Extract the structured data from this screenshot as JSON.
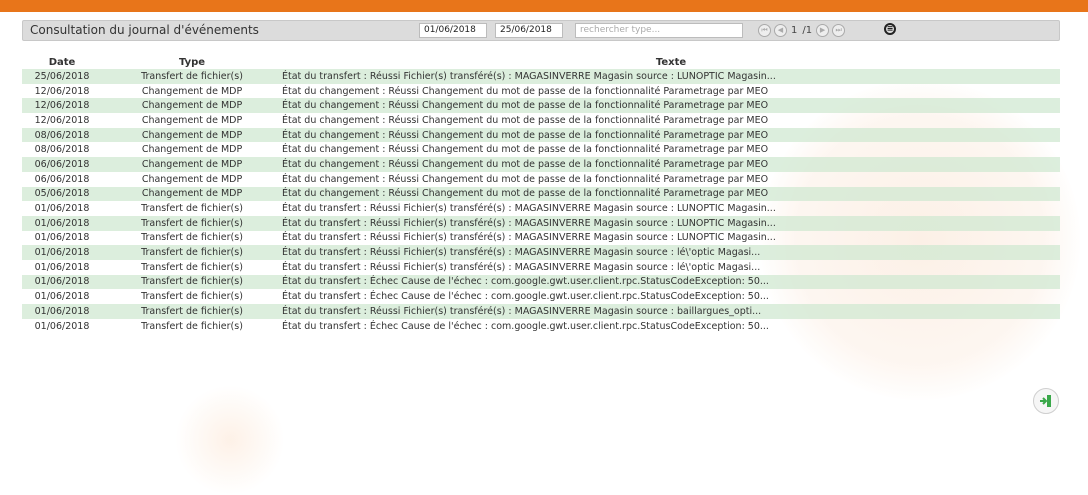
{
  "header": {
    "title": "Consultation du journal d'événements",
    "date_from": "01/06/2018",
    "date_to": "25/06/2018",
    "search_placeholder": "rechercher type...",
    "page_current": "1",
    "page_total": "/1"
  },
  "colors": {
    "topbar": "#e8751a",
    "row_alt": "#d0e8d1",
    "exit_icon": "#3aa84a"
  },
  "table": {
    "columns": [
      "Date",
      "Type",
      "Texte"
    ],
    "rows": [
      {
        "date": "25/06/2018",
        "type": "Transfert de fichier(s)",
        "texte": "État du transfert : Réussi Fichier(s) transféré(s) : MAGASINVERRE Magasin source : LUNOPTIC Magasin..."
      },
      {
        "date": "12/06/2018",
        "type": "Changement de MDP",
        "texte": "État du changement : Réussi Changement du mot de passe de la fonctionnalité Parametrage par MEO"
      },
      {
        "date": "12/06/2018",
        "type": "Changement de MDP",
        "texte": "État du changement : Réussi Changement du mot de passe de la fonctionnalité Parametrage par MEO"
      },
      {
        "date": "12/06/2018",
        "type": "Changement de MDP",
        "texte": "État du changement : Réussi Changement du mot de passe de la fonctionnalité Parametrage par MEO"
      },
      {
        "date": "08/06/2018",
        "type": "Changement de MDP",
        "texte": "État du changement : Réussi Changement du mot de passe de la fonctionnalité Parametrage par MEO"
      },
      {
        "date": "08/06/2018",
        "type": "Changement de MDP",
        "texte": "État du changement : Réussi Changement du mot de passe de la fonctionnalité Parametrage par MEO"
      },
      {
        "date": "06/06/2018",
        "type": "Changement de MDP",
        "texte": "État du changement : Réussi Changement du mot de passe de la fonctionnalité Parametrage par MEO"
      },
      {
        "date": "06/06/2018",
        "type": "Changement de MDP",
        "texte": "État du changement : Réussi Changement du mot de passe de la fonctionnalité Parametrage par MEO"
      },
      {
        "date": "05/06/2018",
        "type": "Changement de MDP",
        "texte": "État du changement : Réussi Changement du mot de passe de la fonctionnalité Parametrage par MEO"
      },
      {
        "date": "01/06/2018",
        "type": "Transfert de fichier(s)",
        "texte": "État du transfert : Réussi Fichier(s) transféré(s) : MAGASINVERRE Magasin source : LUNOPTIC Magasin..."
      },
      {
        "date": "01/06/2018",
        "type": "Transfert de fichier(s)",
        "texte": "État du transfert : Réussi Fichier(s) transféré(s) : MAGASINVERRE Magasin source : LUNOPTIC Magasin..."
      },
      {
        "date": "01/06/2018",
        "type": "Transfert de fichier(s)",
        "texte": "État du transfert : Réussi Fichier(s) transféré(s) : MAGASINVERRE Magasin source : LUNOPTIC Magasin..."
      },
      {
        "date": "01/06/2018",
        "type": "Transfert de fichier(s)",
        "texte": "État du transfert : Réussi Fichier(s) transféré(s) : MAGASINVERRE Magasin source : lé\\'optic Magasi..."
      },
      {
        "date": "01/06/2018",
        "type": "Transfert de fichier(s)",
        "texte": "État du transfert : Réussi Fichier(s) transféré(s) : MAGASINVERRE Magasin source : lé\\'optic Magasi..."
      },
      {
        "date": "01/06/2018",
        "type": "Transfert de fichier(s)",
        "texte": "État du transfert : Échec Cause de l'échec : com.google.gwt.user.client.rpc.StatusCodeException: 50..."
      },
      {
        "date": "01/06/2018",
        "type": "Transfert de fichier(s)",
        "texte": "État du transfert : Échec Cause de l'échec : com.google.gwt.user.client.rpc.StatusCodeException: 50..."
      },
      {
        "date": "01/06/2018",
        "type": "Transfert de fichier(s)",
        "texte": "État du transfert : Réussi Fichier(s) transféré(s) : MAGASINVERRE Magasin source : baillargues_opti..."
      },
      {
        "date": "01/06/2018",
        "type": "Transfert de fichier(s)",
        "texte": "État du transfert : Échec Cause de l'échec : com.google.gwt.user.client.rpc.StatusCodeException: 50..."
      }
    ]
  }
}
